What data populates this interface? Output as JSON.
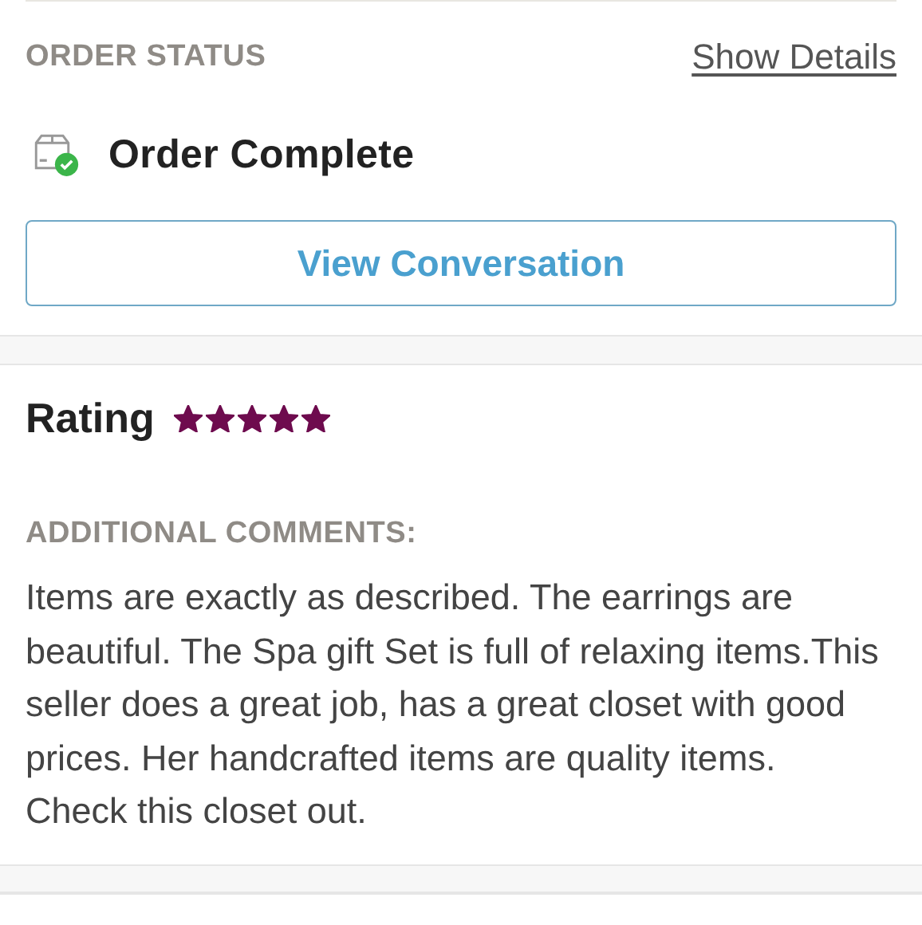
{
  "order_status": {
    "heading": "ORDER STATUS",
    "details_link": "Show Details",
    "status": "Order Complete",
    "complete": true,
    "button": "View Conversation"
  },
  "review": {
    "title": "Rating",
    "stars": 5,
    "comments_heading": "ADDITIONAL COMMENTS:",
    "comment": "Items are exactly as described. The earrings are beautiful. The Spa gift Set is full of relaxing items.This seller does a great job, has a great closet with good prices. Her handcrafted items are quality items. Check this closet out."
  }
}
